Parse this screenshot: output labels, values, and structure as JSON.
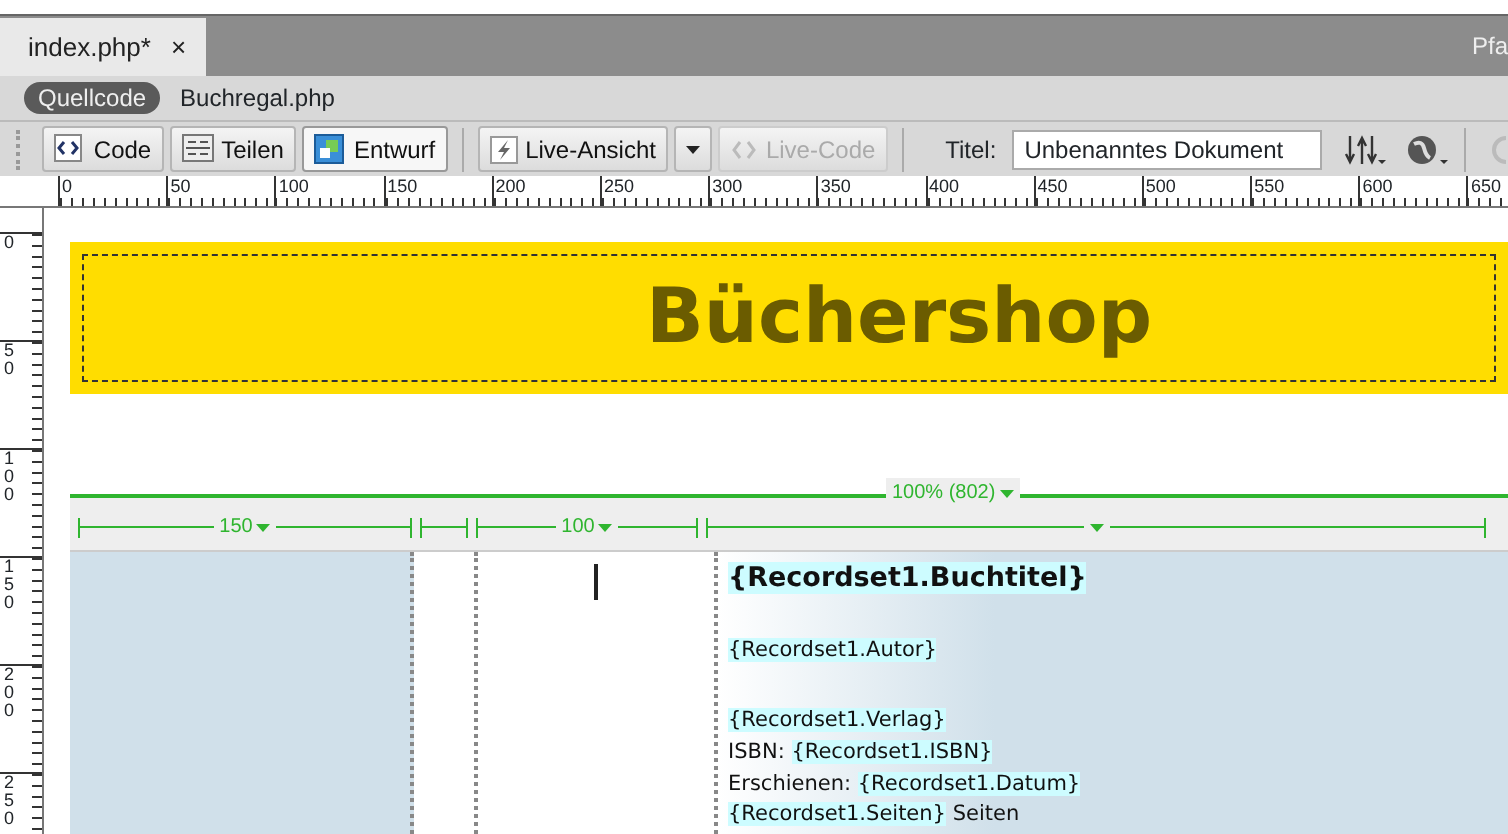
{
  "document_tab": {
    "label": "index.php*",
    "close": "×"
  },
  "path_label": "Pfa",
  "related_files": [
    {
      "label": "Quellcode",
      "selected": true
    },
    {
      "label": "Buchregal.php",
      "selected": false
    }
  ],
  "toolbar": {
    "view_buttons": [
      {
        "label": "Code",
        "kind": "code",
        "selected": false
      },
      {
        "label": "Teilen",
        "kind": "split",
        "selected": false
      },
      {
        "label": "Entwurf",
        "kind": "design",
        "selected": true
      }
    ],
    "live_view": {
      "label": "Live-Ansicht"
    },
    "live_code": {
      "label": "Live-Code",
      "disabled": true
    },
    "title_label": "Titel:",
    "title_value": "Unbenanntes Dokument"
  },
  "ruler": {
    "horizontal": [
      "0",
      "50",
      "100",
      "150",
      "200",
      "250",
      "300",
      "350",
      "400",
      "450",
      "500",
      "550",
      "600",
      "650"
    ],
    "vertical": [
      "0",
      "50",
      "100",
      "150",
      "200",
      "250"
    ]
  },
  "banner": {
    "heading": "Büchershop"
  },
  "table_widths": {
    "table": "100% (802)",
    "columns": [
      {
        "label": "150",
        "menu": true
      },
      {
        "menu": false
      },
      {
        "label": "100",
        "menu": true
      },
      {
        "menu": true
      }
    ]
  },
  "record_paragraphs": [
    [
      [
        {
          "text": "{Recordset1.Buchtitel}",
          "binding": true,
          "kind": "heading"
        }
      ]
    ],
    [
      [
        {
          "text": "{Recordset1.Autor}",
          "binding": true
        }
      ]
    ],
    [
      [
        {
          "text": "{Recordset1.Verlag}",
          "binding": true
        }
      ],
      [
        {
          "text": "ISBN: ",
          "binding": false
        },
        {
          "text": "{Recordset1.ISBN}",
          "binding": true
        }
      ],
      [
        {
          "text": "Erschienen: ",
          "binding": false
        },
        {
          "text": "{Recordset1.Datum}",
          "binding": true
        }
      ],
      [
        {
          "text": "{Recordset1.Seiten}",
          "binding": true
        },
        {
          "text": " Seiten",
          "binding": false
        }
      ]
    ]
  ]
}
